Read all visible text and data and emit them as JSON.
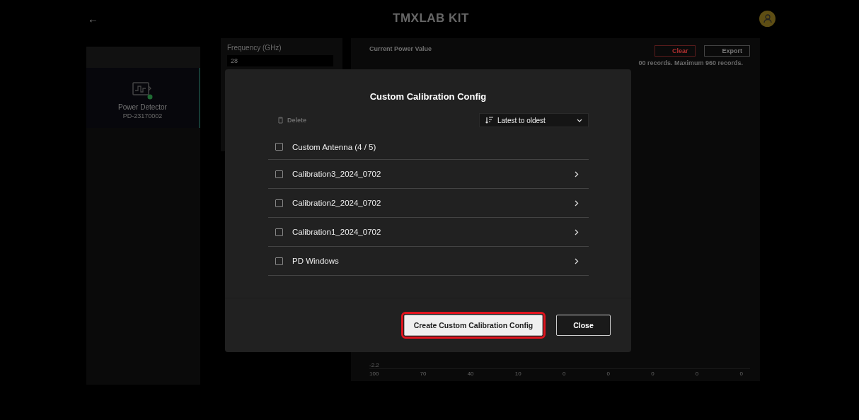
{
  "header": {
    "back": "←",
    "logo": "TMXLAB KIT"
  },
  "sidebar": {
    "devices": [
      {
        "name": "Power Detector",
        "serial": "PD-23170002",
        "selected": true
      }
    ]
  },
  "settings": {
    "frequency_label": "Frequency (GHz)",
    "frequency_value": "28"
  },
  "power_panel": {
    "title": "Current Power Value",
    "clear": "Clear",
    "export": "Export",
    "records_note": "00 records. Maximum 960 records.",
    "y_tick": "-2.2",
    "x_ticks": [
      "100",
      "70",
      "40",
      "10",
      "0",
      "0",
      "0",
      "0",
      "0"
    ]
  },
  "dialog": {
    "title": "Custom Calibration Config",
    "delete": {
      "label": "Delete",
      "disabled": true
    },
    "sort": {
      "value": "Latest to oldest"
    },
    "rows": [
      {
        "kind": "group",
        "label": "Custom Antenna (4 / 5)",
        "checked": false
      },
      {
        "kind": "item",
        "label": "Calibration3_2024_0702",
        "checked": false
      },
      {
        "kind": "item",
        "label": "Calibration2_2024_0702",
        "checked": false
      },
      {
        "kind": "item",
        "label": "Calibration1_2024_0702",
        "checked": false
      },
      {
        "kind": "item",
        "label": "PD Windows",
        "checked": false
      }
    ],
    "buttons": [
      {
        "kind": "primary",
        "label": "Create Custom Calibration Config",
        "highlighted": true
      },
      {
        "kind": "secondary",
        "label": "Close",
        "highlighted": false
      }
    ]
  }
}
